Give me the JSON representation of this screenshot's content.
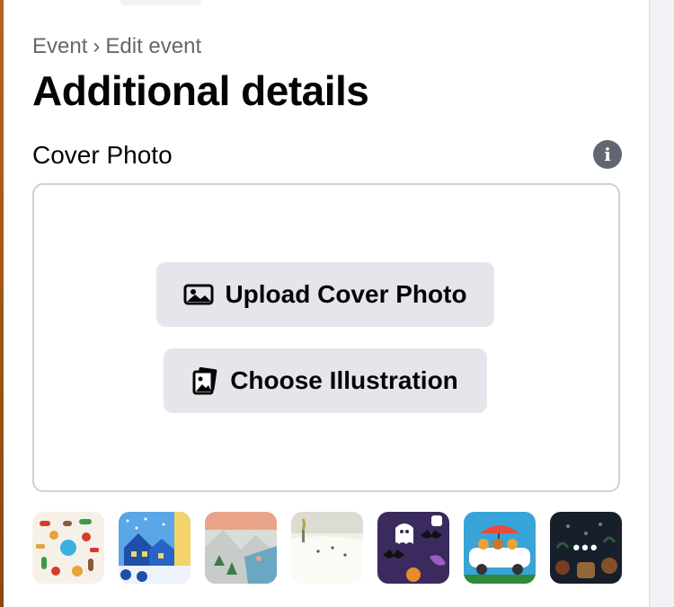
{
  "breadcrumb": {
    "parent": "Event",
    "separator": "›",
    "current": "Edit event"
  },
  "page": {
    "title": "Additional details"
  },
  "cover": {
    "section_title": "Cover Photo",
    "info_icon": "info-icon",
    "upload_label": "Upload Cover Photo",
    "upload_icon": "image-icon",
    "illustration_label": "Choose Illustration",
    "illustration_icon": "illustration-icon"
  },
  "thumbnails": [
    {
      "name": "winter-holiday-pattern"
    },
    {
      "name": "snowy-village"
    },
    {
      "name": "mountain-landscape"
    },
    {
      "name": "snow-field"
    },
    {
      "name": "halloween-bats-ghost"
    },
    {
      "name": "road-trip-van"
    },
    {
      "name": "more-illustrations",
      "more_glyph": "•••"
    }
  ],
  "colors": {
    "panel": "#ffffff",
    "button": "#e4e6eb",
    "muted_text": "#65676b",
    "border": "#ced0d4",
    "info_icon": "#606770"
  }
}
